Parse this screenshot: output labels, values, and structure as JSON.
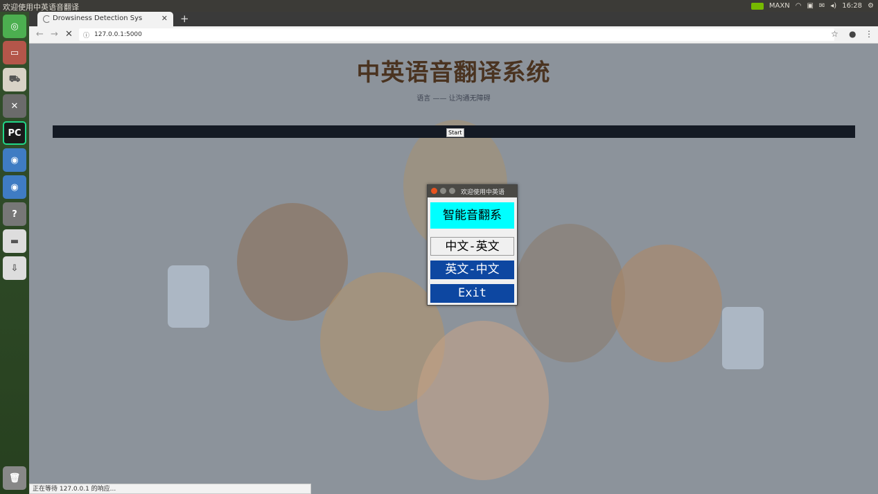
{
  "top_panel": {
    "window_title": "欢迎使用中英语音翻译",
    "nvidia_label": "MAXN",
    "clock": "16:28"
  },
  "launcher": {
    "items": [
      {
        "icon": "ubuntu-logo-icon"
      },
      {
        "icon": "file-manager-icon"
      },
      {
        "icon": "software-center-icon"
      },
      {
        "icon": "system-settings-icon"
      },
      {
        "icon": "pycharm-icon",
        "label": "PC"
      },
      {
        "icon": "chromium-icon"
      },
      {
        "icon": "chromium-icon"
      },
      {
        "icon": "help-icon",
        "label": "?"
      },
      {
        "icon": "drive-icon"
      },
      {
        "icon": "usb-drive-icon"
      },
      {
        "icon": "trash-icon"
      }
    ]
  },
  "browser": {
    "tab_title": "Drowsiness Detection Sys",
    "url": "127.0.0.1:5000",
    "status_text": "正在等待 127.0.0.1 的响应..."
  },
  "page": {
    "hero_title": "中英语音翻译系统",
    "hero_subtitle": "语言 —— 让沟通无障碍",
    "start_label": "Start"
  },
  "dialog": {
    "title": "欢迎使用中英语",
    "banner": "智能音翻系",
    "btn_cn_en": "中文-英文",
    "btn_en_cn": "英文-中文",
    "btn_exit": "Exit",
    "colors": {
      "banner": "#00ffff",
      "button_blue": "#0d47a1"
    }
  }
}
